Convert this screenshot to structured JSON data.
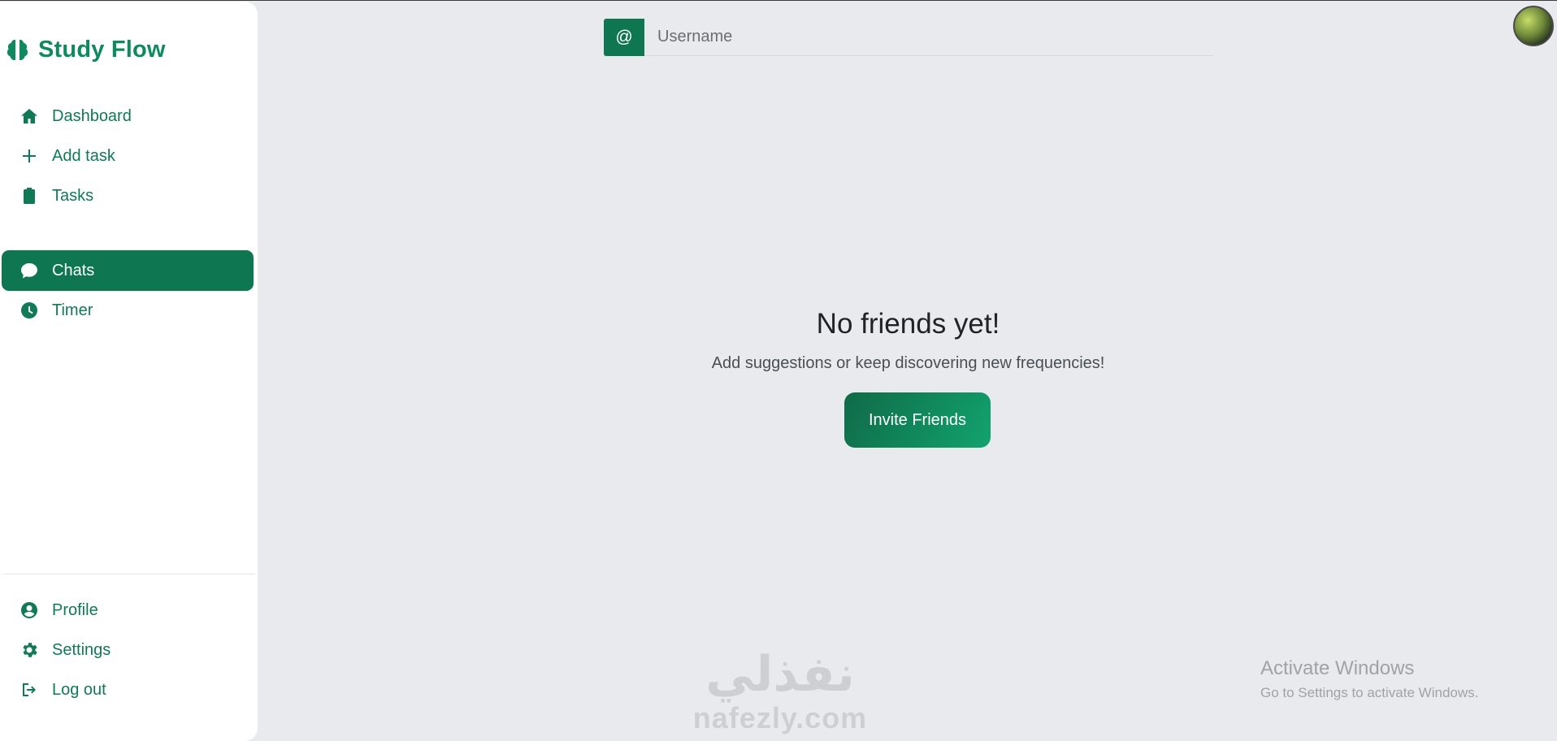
{
  "brand": {
    "name": "Study Flow",
    "icon": "brain-icon",
    "color": "#0f8a5f"
  },
  "nav": {
    "items": [
      {
        "label": "Dashboard",
        "icon": "home-icon"
      },
      {
        "label": "Add task",
        "icon": "plus-icon"
      },
      {
        "label": "Tasks",
        "icon": "clipboard-icon"
      },
      {
        "label": "Chats",
        "icon": "chat-bubble-icon",
        "active": true
      },
      {
        "label": "Timer",
        "icon": "clock-icon"
      }
    ],
    "bottom": [
      {
        "label": "Profile",
        "icon": "user-circle-icon"
      },
      {
        "label": "Settings",
        "icon": "gear-icon"
      },
      {
        "label": "Log out",
        "icon": "logout-icon"
      }
    ]
  },
  "search": {
    "prefix": "@",
    "placeholder": "Username"
  },
  "empty_state": {
    "title": "No friends yet!",
    "subtitle": "Add suggestions or keep discovering new frequencies!",
    "button": "Invite Friends"
  },
  "watermark": {
    "arabic": "نفذلي",
    "latin": "nafezly.com"
  },
  "system": {
    "activate_title": "Activate Windows",
    "activate_sub": "Go to Settings to activate Windows."
  },
  "colors": {
    "accent": "#0e7751",
    "background": "#e8eaee"
  }
}
